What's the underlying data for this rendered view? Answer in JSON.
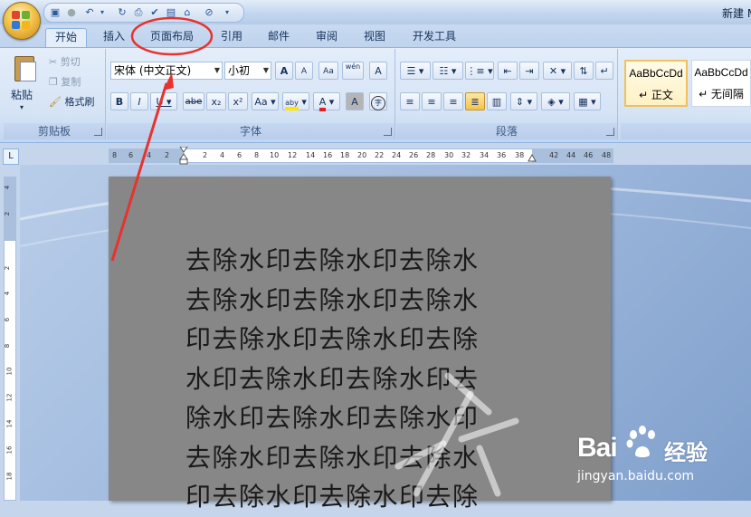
{
  "window": {
    "title": "新建 M"
  },
  "tabs": [
    {
      "label": "开始",
      "active": true
    },
    {
      "label": "插入"
    },
    {
      "label": "页面布局",
      "highlighted": true
    },
    {
      "label": "引用"
    },
    {
      "label": "邮件"
    },
    {
      "label": "审阅"
    },
    {
      "label": "视图"
    },
    {
      "label": "开发工具"
    }
  ],
  "clipboard": {
    "paste": "粘贴",
    "cut": "剪切",
    "copy": "复制",
    "format_painter": "格式刷",
    "group_label": "剪贴板"
  },
  "font": {
    "font_name": "宋体 (中文正文)",
    "font_size": "小初",
    "bold": "B",
    "italic": "I",
    "underline": "U",
    "strikethrough": "abe",
    "subscript": "x₂",
    "superscript": "x²",
    "change_case": "Aa",
    "grow_font": "A",
    "shrink_font": "A",
    "phonetic": "wén",
    "char_border": "A",
    "highlight": "aby",
    "font_color": "A",
    "char_shading": "A",
    "enclose": "字",
    "group_label": "字体"
  },
  "paragraph": {
    "group_label": "段落"
  },
  "styles": {
    "items": [
      {
        "sample": "AaBbCcDd",
        "name": "↵ 正文",
        "selected": true
      },
      {
        "sample": "AaBbCcDd",
        "name": "↵ 无间隔"
      }
    ]
  },
  "ruler": {
    "h_labels": [
      "8",
      "6",
      "4",
      "2",
      "2",
      "4",
      "6",
      "8",
      "10",
      "12",
      "14",
      "16",
      "18",
      "20",
      "22",
      "24",
      "26",
      "28",
      "30",
      "32",
      "34",
      "36",
      "38",
      "42",
      "44",
      "46",
      "48"
    ],
    "v_labels": [
      "4",
      "2",
      "2",
      "4",
      "6",
      "8",
      "10",
      "12",
      "14",
      "16",
      "18"
    ]
  },
  "document": {
    "lines": [
      "去除水印去除水印去除水",
      "去除水印去除水印去除水",
      "印去除水印去除水印去除",
      "水印去除水印去除水印去",
      "除水印去除水印去除水印",
      "去除水印去除水印去除水",
      "印去除水印去除水印去除"
    ]
  },
  "watermark": {
    "brand": "Bai",
    "brand_cn": "经验",
    "url": "jingyan.baidu.com"
  },
  "colors": {
    "highlight_yellow": "#ffe600",
    "font_color_red": "#e0201a",
    "annotation_red": "#e8322e"
  }
}
